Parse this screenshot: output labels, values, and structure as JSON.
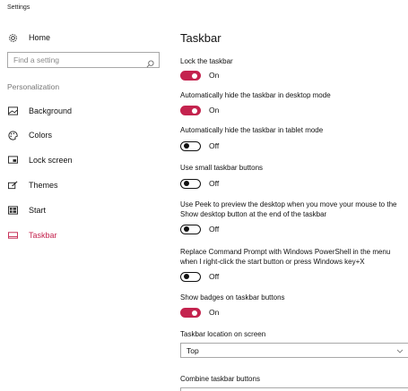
{
  "window": {
    "title": "Settings"
  },
  "nav": {
    "home": "Home",
    "search_placeholder": "Find a setting",
    "section": "Personalization",
    "items": [
      {
        "label": "Background",
        "icon": "picture-icon"
      },
      {
        "label": "Colors",
        "icon": "palette-icon"
      },
      {
        "label": "Lock screen",
        "icon": "lock-screen-icon"
      },
      {
        "label": "Themes",
        "icon": "brush-icon"
      },
      {
        "label": "Start",
        "icon": "start-icon"
      },
      {
        "label": "Taskbar",
        "icon": "taskbar-icon",
        "active": true
      }
    ]
  },
  "main": {
    "title": "Taskbar",
    "settings": [
      {
        "label": "Lock the taskbar",
        "state": "On"
      },
      {
        "label": "Automatically hide the taskbar in desktop mode",
        "state": "On"
      },
      {
        "label": "Automatically hide the taskbar in tablet mode",
        "state": "Off"
      },
      {
        "label": "Use small taskbar buttons",
        "state": "Off"
      },
      {
        "label": "Use Peek to preview the desktop when you move your mouse to the Show desktop button at the end of the taskbar",
        "state": "Off"
      },
      {
        "label": "Replace Command Prompt with Windows PowerShell in the menu when I right-click the start button or press Windows key+X",
        "state": "Off"
      },
      {
        "label": "Show badges on taskbar buttons",
        "state": "On"
      }
    ],
    "location_label": "Taskbar location on screen",
    "location_value": "Top",
    "combine_label": "Combine taskbar buttons"
  },
  "colors": {
    "accent": "#c4234e",
    "toggle_off": "#111111",
    "border": "#a8a8a8"
  }
}
